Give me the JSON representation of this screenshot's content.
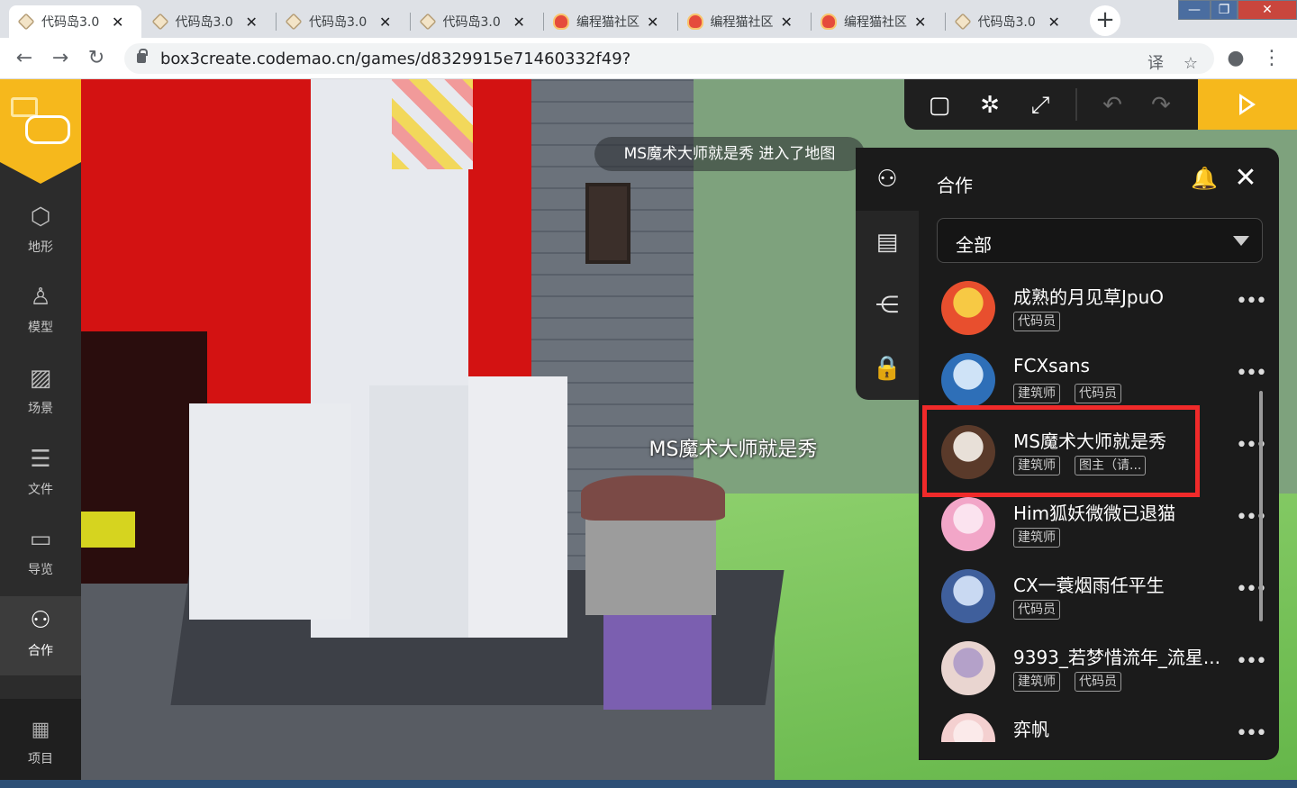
{
  "browser": {
    "tabs": [
      {
        "title": "代码岛3.0",
        "icon": "box-icon",
        "active": true
      },
      {
        "title": "代码岛3.0",
        "icon": "box-icon"
      },
      {
        "title": "代码岛3.0",
        "icon": "box-icon"
      },
      {
        "title": "代码岛3.0",
        "icon": "box-icon"
      },
      {
        "title": "编程猫社区",
        "icon": "cat-icon"
      },
      {
        "title": "编程猫社区",
        "icon": "cat-icon"
      },
      {
        "title": "编程猫社区",
        "icon": "cat-icon"
      },
      {
        "title": "代码岛3.0",
        "icon": "box-icon"
      }
    ],
    "tab_close": "✕",
    "new_tab": "+",
    "url": "box3create.codemao.cn/games/d8329915e71460332f49?",
    "back": "←",
    "forward": "→",
    "reload": "↻",
    "translate": "译",
    "star": "☆",
    "profile": "●",
    "menu": "⋮",
    "win_min": "—",
    "win_max": "❐",
    "win_close": "✕"
  },
  "sidebar": {
    "items": [
      {
        "label": "地形",
        "icon": "cube-icon",
        "glyph": "⬡"
      },
      {
        "label": "模型",
        "icon": "model-icon",
        "glyph": "♙"
      },
      {
        "label": "场景",
        "icon": "image-icon",
        "glyph": "▨"
      },
      {
        "label": "文件",
        "icon": "file-icon",
        "glyph": "☰"
      },
      {
        "label": "导览",
        "icon": "folder-icon",
        "glyph": "▭"
      },
      {
        "label": "合作",
        "icon": "users-icon",
        "glyph": "⚇"
      }
    ],
    "project": {
      "label": "项目",
      "glyph": "▦"
    }
  },
  "scene": {
    "toast": "MS魔术大师就是秀 进入了地图",
    "player_name": "MS魔术大师就是秀"
  },
  "toolbar": {
    "chat": "▢",
    "debug": "✲",
    "resize": "⤢",
    "undo": "↶",
    "redo": "↷"
  },
  "collab": {
    "title": "合作",
    "bell": "🔔",
    "close": "✕",
    "filter": "全部",
    "tab_glyphs": {
      "users": "⚇",
      "card": "▤",
      "share": "⋲",
      "lock": "🔒"
    },
    "more": "•••",
    "users": [
      {
        "name": "成熟的月见草JpuO",
        "badges": [
          "代码员"
        ],
        "avatar_color": "#e84f2e",
        "avatar_color2": "#f7c944"
      },
      {
        "name": "FCXsans",
        "badges": [
          "建筑师",
          "代码员"
        ],
        "avatar_color": "#2e6fb8",
        "avatar_color2": "#cfe3f7"
      },
      {
        "name": "MS魔术大师就是秀",
        "badges": [
          "建筑师",
          "图主（请..."
        ],
        "avatar_color": "#5a3a2a",
        "avatar_color2": "#e8e0d8"
      },
      {
        "name": "Him狐妖微微已退猫",
        "badges": [
          "建筑师"
        ],
        "avatar_color": "#f2a6c8",
        "avatar_color2": "#fbe3ef"
      },
      {
        "name": "CX一蓑烟雨任平生",
        "badges": [
          "代码员"
        ],
        "avatar_color": "#3f5f9c",
        "avatar_color2": "#c9d9f2"
      },
      {
        "name": "9393_若梦惜流年_流星...",
        "badges": [
          "建筑师",
          "代码员"
        ],
        "avatar_color": "#e9d5d0",
        "avatar_color2": "#b4a1c9"
      },
      {
        "name": "弈帆",
        "badges": [],
        "avatar_color": "#f4d0d0",
        "avatar_color2": "#fbeaea"
      }
    ]
  },
  "colors": {
    "accent": "#f6b81c",
    "highlight": "#f02a2a"
  }
}
